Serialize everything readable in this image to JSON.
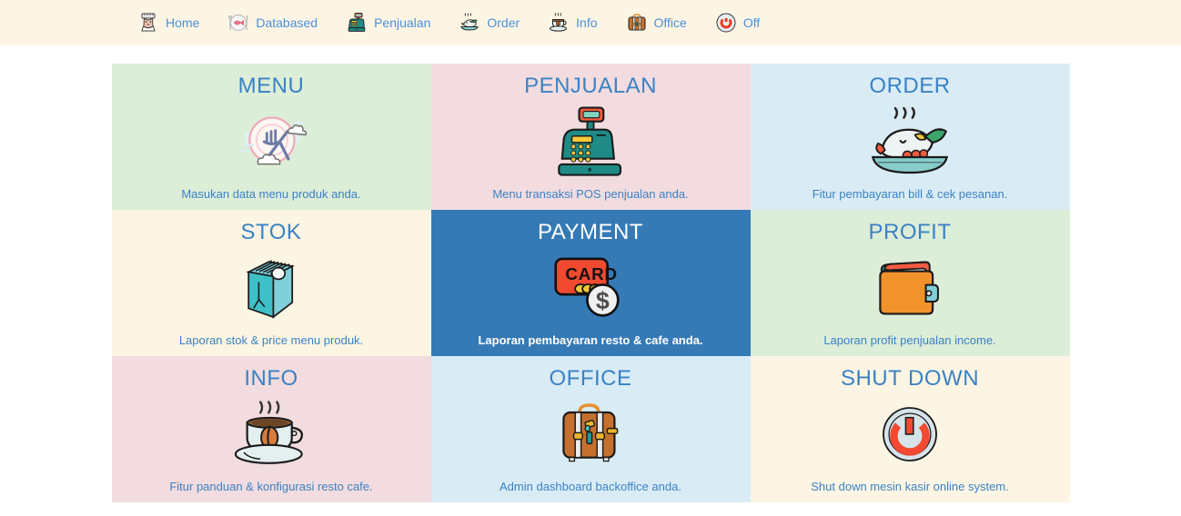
{
  "navbar": {
    "background": "#fdf5e4",
    "link_color": "#4a90d9",
    "items": [
      {
        "label": "Home",
        "icon": "chef-hat-icon"
      },
      {
        "label": "Databased",
        "icon": "plate-fish-icon"
      },
      {
        "label": "Penjualan",
        "icon": "cash-register-icon"
      },
      {
        "label": "Order",
        "icon": "fish-dish-icon"
      },
      {
        "label": "Info",
        "icon": "coffee-cup-icon"
      },
      {
        "label": "Office",
        "icon": "briefcase-icon"
      },
      {
        "label": "Off",
        "icon": "power-icon"
      }
    ]
  },
  "colors": {
    "title_blue": "#3b82c4",
    "active_blue": "#357ab5",
    "green": "#dcedd8",
    "pink": "#f2dcdf",
    "light_blue": "#d9ecf6",
    "cream": "#fcf5e3"
  },
  "grid": {
    "tiles": [
      {
        "title": "MENU",
        "caption": "Masukan data menu produk anda.",
        "icon": "plate-fork-icon",
        "bg": "#dcedd8",
        "active": false
      },
      {
        "title": "PENJUALAN",
        "caption": "Menu transaksi POS penjualan anda.",
        "icon": "cash-register-icon",
        "bg": "#f2dcdf",
        "active": false
      },
      {
        "title": "ORDER",
        "caption": "Fitur pembayaran bill & cek pesanan.",
        "icon": "fish-dish-icon",
        "bg": "#d9ecf6",
        "active": false
      },
      {
        "title": "STOK",
        "caption": "Laporan stok & price menu produk.",
        "icon": "milk-carton-icon",
        "bg": "#fcf5e3",
        "active": false
      },
      {
        "title": "PAYMENT",
        "caption": "Laporan pembayaran resto & cafe anda.",
        "icon": "credit-card-coin-icon",
        "bg": "#357ab5",
        "active": true
      },
      {
        "title": "PROFIT",
        "caption": "Laporan profit penjualan income.",
        "icon": "wallet-icon",
        "bg": "#dcedd8",
        "active": false
      },
      {
        "title": "INFO",
        "caption": "Fitur panduan & konfigurasi resto cafe.",
        "icon": "coffee-cup-icon",
        "bg": "#f2dcdf",
        "active": false
      },
      {
        "title": "OFFICE",
        "caption": "Admin dashboard backoffice anda.",
        "icon": "briefcase-icon",
        "bg": "#d9ecf6",
        "active": false
      },
      {
        "title": "SHUT DOWN",
        "caption": "Shut down mesin kasir online system.",
        "icon": "power-button-icon",
        "bg": "#fcf5e3",
        "active": false
      }
    ]
  }
}
